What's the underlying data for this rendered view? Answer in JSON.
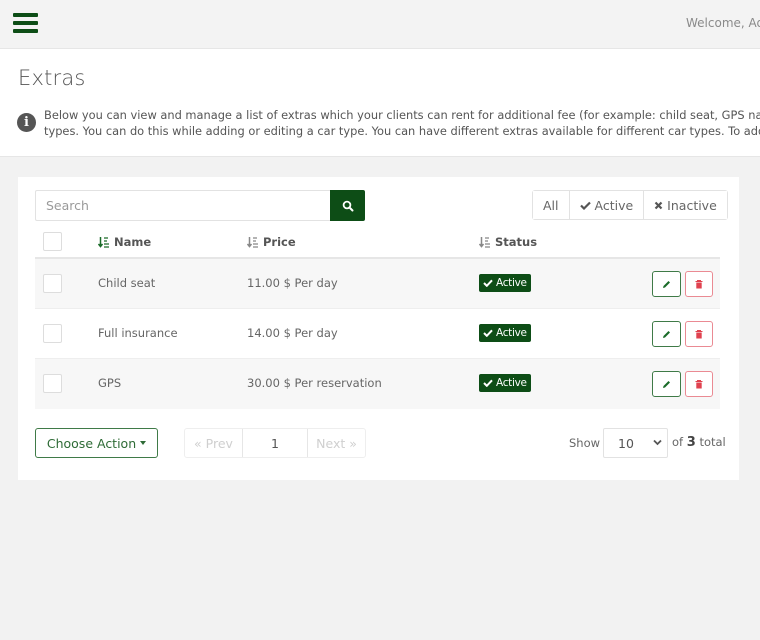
{
  "topbar": {
    "menu_icon": "hamburger-icon",
    "welcome_text": "Welcome, Adm"
  },
  "header": {
    "title": "Extras",
    "info_icon": "info-circle-icon",
    "info_line1": "Below you can view and manage a list of extras which your clients can rent for additional fee (for example: child seat, GPS navigation, e",
    "info_line2": "types. You can do this while adding or editing a car type. You can have different extras available for different car types. To add new ext"
  },
  "toolbar": {
    "search_placeholder": "Search",
    "search_value": "",
    "search_icon": "search-icon",
    "filters": [
      {
        "label": "All",
        "icon": ""
      },
      {
        "label": "Active",
        "icon": "check-icon"
      },
      {
        "label": "Inactive",
        "icon": "times-icon"
      }
    ]
  },
  "table": {
    "columns": [
      {
        "label": "Name",
        "sort_icon": "sort-amount-icon",
        "active": true
      },
      {
        "label": "Price",
        "sort_icon": "sort-amount-icon",
        "active": false
      },
      {
        "label": "Status",
        "sort_icon": "sort-amount-icon",
        "active": false
      }
    ],
    "rows": [
      {
        "name": "Child seat",
        "price": "11.00 $ Per day",
        "status": "Active"
      },
      {
        "name": "Full insurance",
        "price": "14.00 $ Per day",
        "status": "Active"
      },
      {
        "name": "GPS",
        "price": "30.00 $ Per reservation",
        "status": "Active"
      }
    ]
  },
  "footer": {
    "choose_action_label": "Choose Action",
    "prev_label": "« Prev",
    "page_value": "1",
    "next_label": "Next »",
    "show_label": "Show",
    "page_size": "10",
    "total_prefix": "of",
    "total_count": "3",
    "total_suffix": "total"
  },
  "colors": {
    "brand_green": "#0d4d16",
    "danger_red": "#e0424f",
    "background": "#f2f2f2"
  }
}
